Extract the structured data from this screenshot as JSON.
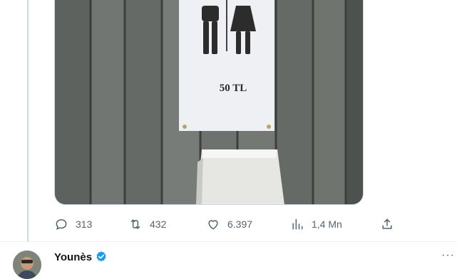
{
  "media": {
    "sign_text": "50 TL"
  },
  "actions": {
    "reply": {
      "icon": "reply-icon",
      "count": "313"
    },
    "retweet": {
      "icon": "retweet-icon",
      "count": "432"
    },
    "like": {
      "icon": "heart-icon",
      "count": "6.397"
    },
    "views": {
      "icon": "views-icon",
      "count": "1,4 Mn"
    },
    "share": {
      "icon": "share-icon"
    }
  },
  "next_tweet": {
    "author_name": "Younès",
    "verified": true,
    "more_label": "···"
  },
  "colors": {
    "muted": "#536471",
    "verified_blue": "#1d9bf0",
    "border": "#cfd9de"
  }
}
